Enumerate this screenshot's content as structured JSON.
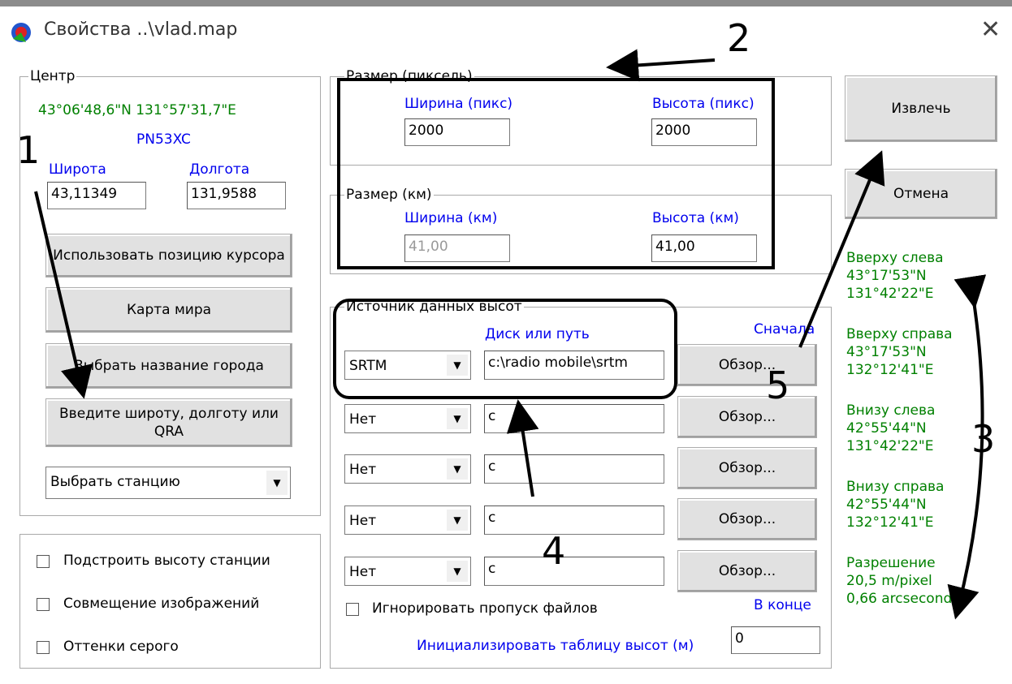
{
  "window": {
    "title": "Свойства ..\\vlad.map",
    "close": "✕"
  },
  "center": {
    "label": "Центр",
    "coords": "43°06'48,6\"N 131°57'31,7\"E",
    "qra": "PN53XC",
    "lat_label": "Широта",
    "lon_label": "Долгота",
    "lat": "43,11349",
    "lon": "131,9588",
    "btn_cursor": "Использовать позицию курсора",
    "btn_world": "Карта мира",
    "btn_city": "Выбрать название города",
    "btn_enter": "Введите широту, долготу или QRA",
    "station_select": "Выбрать станцию"
  },
  "options": {
    "adjust_height": "Подстроить высоту станции",
    "merge_images": "Совмещение изображений",
    "grayscale": "Оттенки серого"
  },
  "size_px": {
    "label": "Размер (пиксель)",
    "width_label": "Ширина (пикс)",
    "height_label": "Высота (пикс)",
    "width": "2000",
    "height": "2000"
  },
  "size_km": {
    "label": "Размер (км)",
    "width_label": "Ширина (км)",
    "height_label": "Высота (км)",
    "width": "41,00",
    "height": "41,00"
  },
  "elevation": {
    "label": "Источник данных высот",
    "path_header": "Диск или путь",
    "first_label": "Сначала",
    "last_label": "В конце",
    "rows": [
      {
        "source": "SRTM",
        "path": "c:\\radio mobile\\srtm",
        "browse": "Обзор..."
      },
      {
        "source": "Нет",
        "path": "c",
        "browse": "Обзор..."
      },
      {
        "source": "Нет",
        "path": "c",
        "browse": "Обзор..."
      },
      {
        "source": "Нет",
        "path": "c",
        "browse": "Обзор..."
      },
      {
        "source": "Нет",
        "path": "c",
        "browse": "Обзор..."
      }
    ],
    "ignore_missing": "Игнорировать пропуск файлов",
    "init_table_label": "Инициализировать таблицу высот (м)",
    "init_table_value": "0"
  },
  "actions": {
    "extract": "Извлечь",
    "cancel": "Отмена"
  },
  "corners": {
    "top_left_label": "Вверху слева",
    "top_left_lat": "43°17'53\"N",
    "top_left_lon": "131°42'22\"E",
    "top_right_label": "Вверху справа",
    "top_right_lat": "43°17'53\"N",
    "top_right_lon": "132°12'41\"E",
    "bottom_left_label": "Внизу слева",
    "bottom_left_lat": "42°55'44\"N",
    "bottom_left_lon": "131°42'22\"E",
    "bottom_right_label": "Внизу справа",
    "bottom_right_lat": "42°55'44\"N",
    "bottom_right_lon": "132°12'41\"E",
    "resolution_label": "Разрешение",
    "resolution_m": "20,5 m/pixel",
    "resolution_arc": "0,66 arcsecond"
  },
  "annotations": {
    "n1": "1",
    "n2": "2",
    "n3": "3",
    "n4": "4",
    "n5": "5"
  },
  "colors": {
    "label_blue": "#0000ee",
    "coord_green": "#008000"
  }
}
